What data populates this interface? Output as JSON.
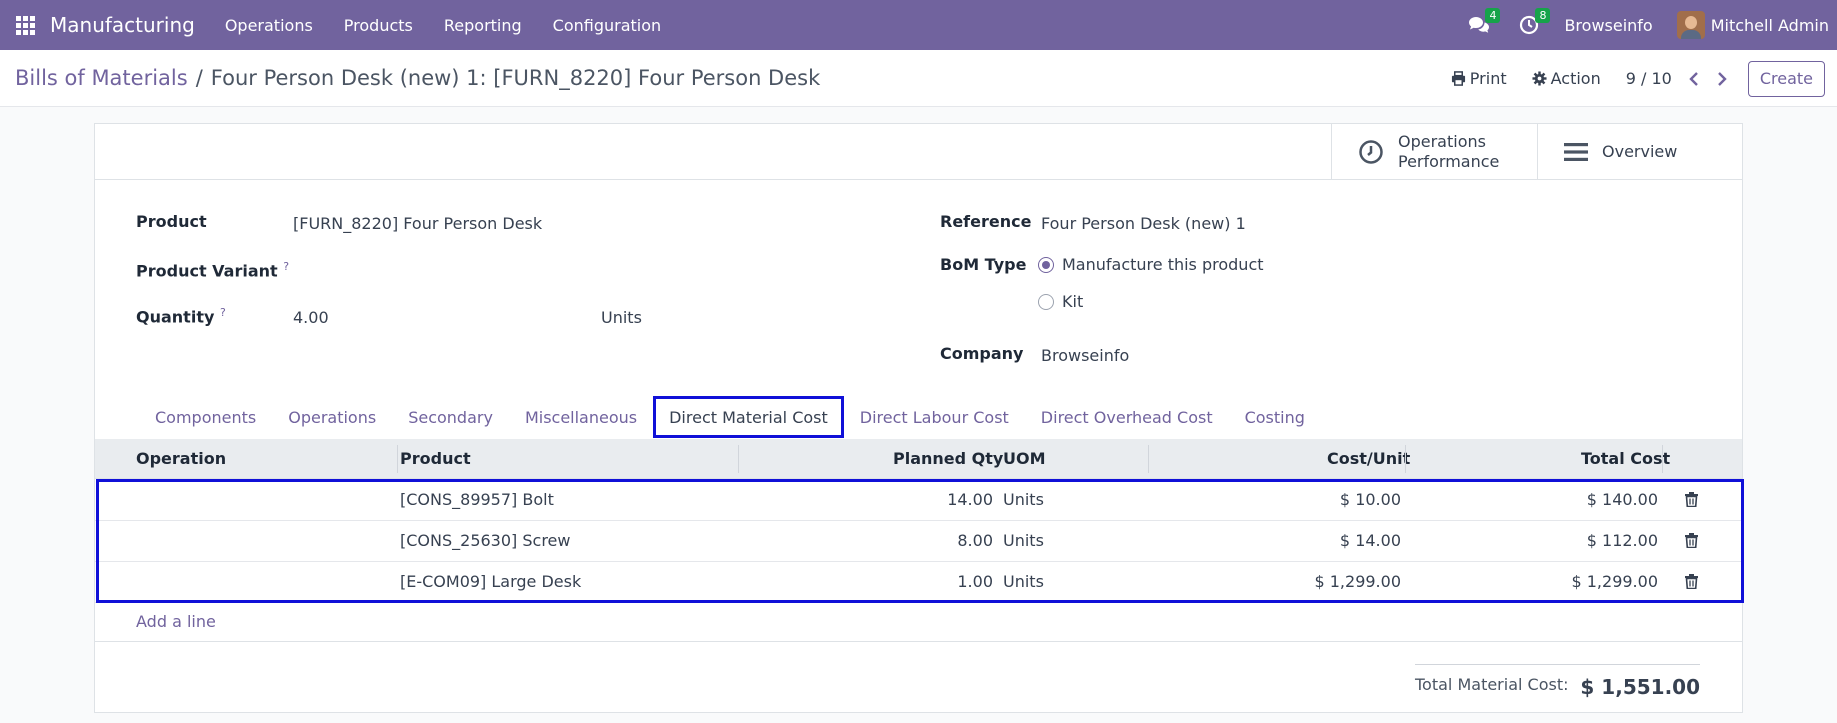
{
  "navbar": {
    "app_name": "Manufacturing",
    "menu": [
      "Operations",
      "Products",
      "Reporting",
      "Configuration"
    ],
    "messages_count": "4",
    "activities_count": "8",
    "company": "Browseinfo",
    "user": "Mitchell Admin"
  },
  "control_panel": {
    "breadcrumb_parent": "Bills of Materials",
    "breadcrumb_separator": "/",
    "breadcrumb_current": "Four Person Desk (new) 1: [FURN_8220] Four Person Desk",
    "print_label": "Print",
    "action_label": "Action",
    "pager": "9 / 10",
    "create_label": "Create"
  },
  "smart_buttons": {
    "operations_line1": "Operations",
    "operations_line2": "Performance",
    "overview": "Overview"
  },
  "form": {
    "product_label": "Product",
    "product_value": "[FURN_8220] Four Person Desk",
    "variant_label": "Product Variant",
    "help_mark": "?",
    "quantity_label": "Quantity",
    "quantity_value": "4.00",
    "quantity_uom": "Units",
    "reference_label": "Reference",
    "reference_value": "Four Person Desk (new) 1",
    "bom_type_label": "BoM Type",
    "bom_type_option1": "Manufacture this product",
    "bom_type_option2": "Kit",
    "company_label": "Company",
    "company_value": "Browseinfo"
  },
  "tabs": [
    "Components",
    "Operations",
    "Secondary",
    "Miscellaneous",
    "Direct Material Cost",
    "Direct Labour Cost",
    "Direct Overhead Cost",
    "Costing"
  ],
  "active_tab": "Direct Material Cost",
  "table": {
    "headers": {
      "operation": "Operation",
      "product": "Product",
      "planned_qty": "Planned Qty",
      "uom": "UOM",
      "cost_unit": "Cost/Unit",
      "total_cost": "Total Cost"
    },
    "rows": [
      {
        "operation": "",
        "product": "[CONS_89957] Bolt",
        "planned_qty": "14.00",
        "uom": "Units",
        "cost_unit": "$ 10.00",
        "total_cost": "$ 140.00"
      },
      {
        "operation": "",
        "product": "[CONS_25630] Screw",
        "planned_qty": "8.00",
        "uom": "Units",
        "cost_unit": "$ 14.00",
        "total_cost": "$ 112.00"
      },
      {
        "operation": "",
        "product": "[E-COM09] Large Desk",
        "planned_qty": "1.00",
        "uom": "Units",
        "cost_unit": "$ 1,299.00",
        "total_cost": "$ 1,299.00"
      }
    ],
    "add_line": "Add a line"
  },
  "totals": {
    "label": "Total Material Cost:",
    "value": "$ 1,551.00"
  },
  "colors": {
    "brand": "#71639e",
    "highlight": "#1010d8",
    "badge": "#16a34a"
  }
}
